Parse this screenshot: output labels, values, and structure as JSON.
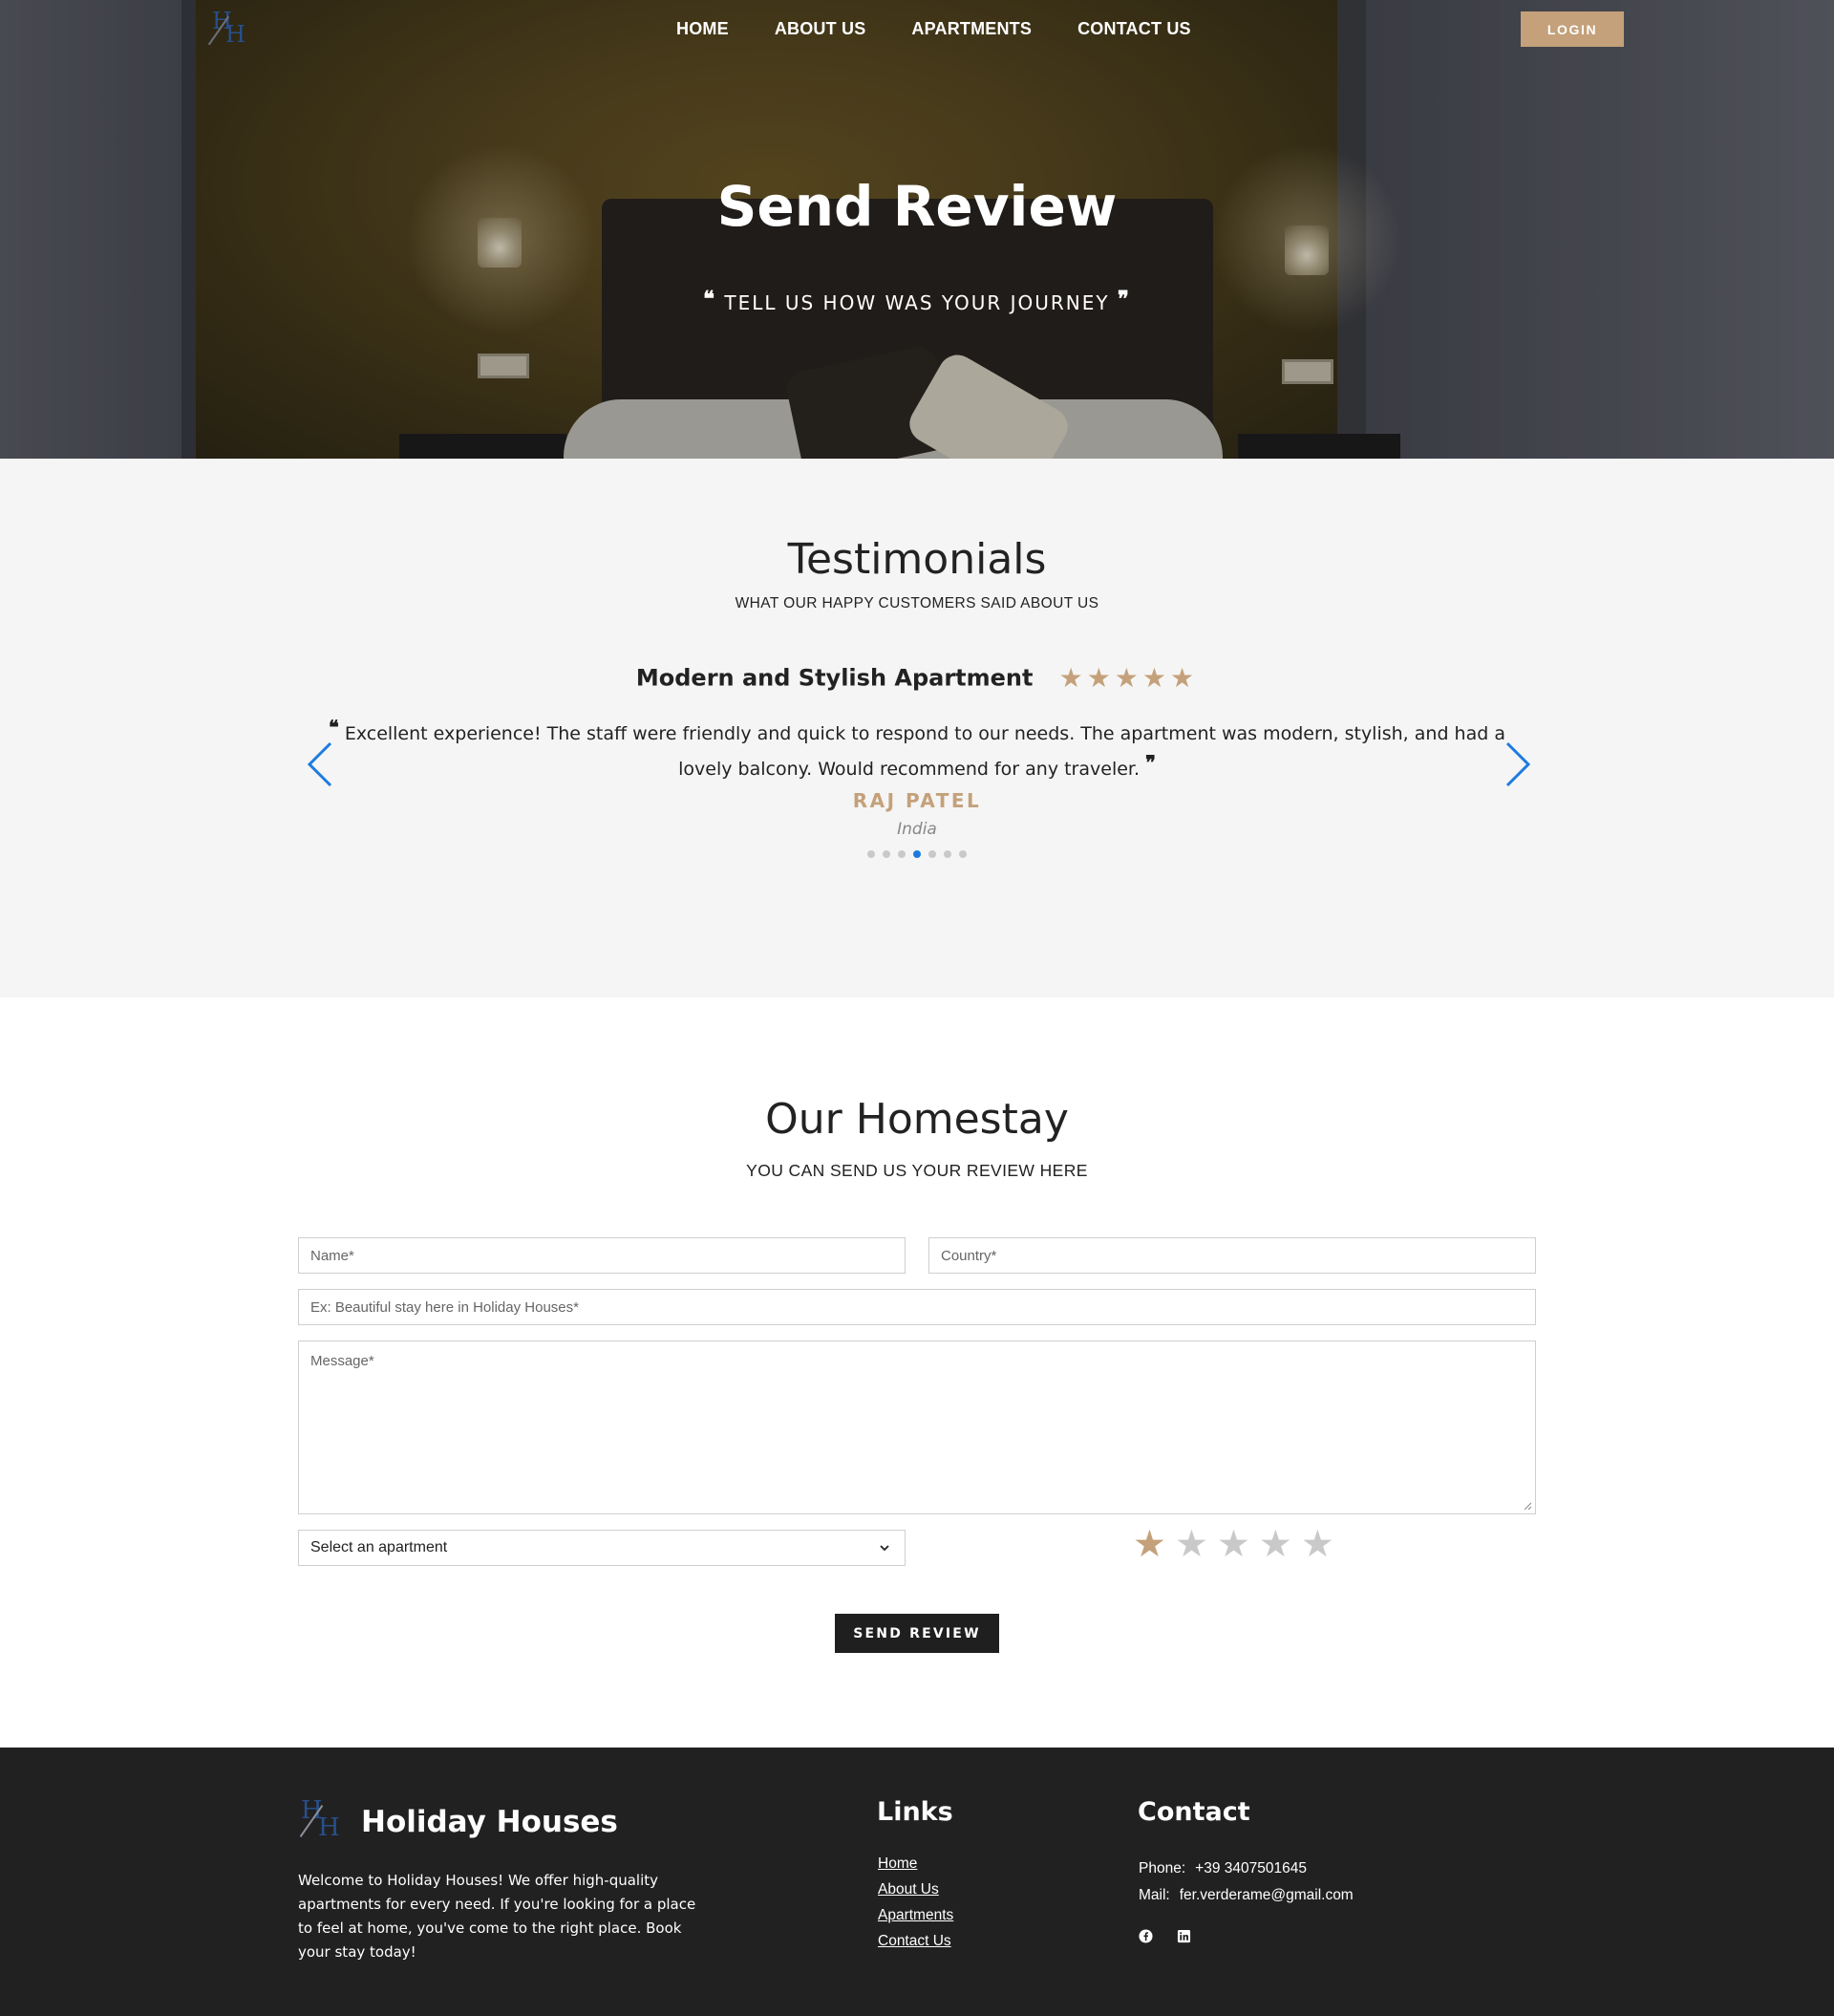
{
  "nav": {
    "logo_text": "H/H",
    "links": [
      "HOME",
      "ABOUT US",
      "APARTMENTS",
      "CONTACT US"
    ],
    "login_label": "LOGIN"
  },
  "hero": {
    "title": "Send Review",
    "subtitle_open_quote": "❝",
    "subtitle": "TELL US HOW WAS YOUR JOURNEY",
    "subtitle_close_quote": "❞"
  },
  "testimonials": {
    "title": "Testimonials",
    "subtitle": "WHAT OUR HAPPY CUSTOMERS SAID ABOUT US",
    "current": {
      "title": "Modern and Stylish Apartment",
      "rating": 5,
      "open_quote": "❝",
      "text": "Excellent experience! The staff were friendly and quick to respond to our needs. The apartment was modern, stylish, and had a lovely balcony. Would recommend for any traveler.",
      "close_quote": "❞",
      "name": "RAJ PATEL",
      "country": "India"
    },
    "slide_count": 7,
    "active_slide": 4
  },
  "form": {
    "title": "Our Homestay",
    "subtitle": "YOU CAN SEND US YOUR REVIEW HERE",
    "name_placeholder": "Name*",
    "country_placeholder": "Country*",
    "title_placeholder": "Ex: Beautiful stay here in Holiday Houses*",
    "message_placeholder": "Message*",
    "apartment_select": "Select an apartment",
    "rating_selected": 1,
    "rating_max": 5,
    "submit_label": "SEND REVIEW"
  },
  "footer": {
    "brand": "Holiday Houses",
    "about": "Welcome to Holiday Houses! We offer high-quality apartments for every need. If you're looking for a place to feel at home, you've come to the right place. Book your stay today!",
    "links_title": "Links",
    "links": [
      "Home",
      "About Us",
      "Apartments",
      "Contact Us"
    ],
    "contact_title": "Contact",
    "phone_label": "Phone:",
    "phone": "+39 3407501645",
    "mail_label": "Mail:",
    "mail": "fer.verderame@gmail.com",
    "social_icons": [
      "facebook-icon",
      "linkedin-icon"
    ]
  },
  "colors": {
    "accent": "#c4a17a",
    "dark": "#1f1f1f",
    "light_bg": "#f5f5f5",
    "carousel_blue": "#1d7be0"
  }
}
